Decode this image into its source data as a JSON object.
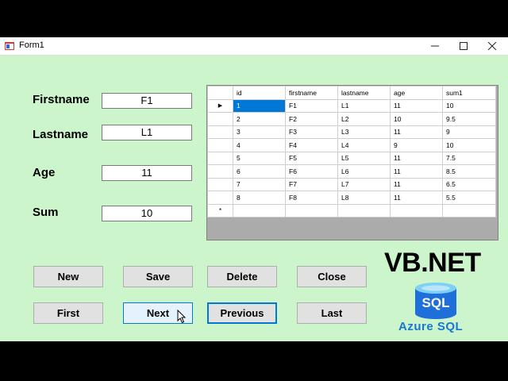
{
  "window": {
    "title": "Form1",
    "minimize": "—",
    "maximize": "☐",
    "close": "✕"
  },
  "form": {
    "firstname_label": "Firstname",
    "firstname_value": "F1",
    "lastname_label": "Lastname",
    "lastname_value": "L1",
    "age_label": "Age",
    "age_value": "11",
    "sum_label": "Sum",
    "sum_value": "10"
  },
  "grid": {
    "columns": [
      "id",
      "firstname",
      "lastname",
      "age",
      "sum1"
    ],
    "rows": [
      [
        "1",
        "F1",
        "L1",
        "11",
        "10"
      ],
      [
        "2",
        "F2",
        "L2",
        "10",
        "9.5"
      ],
      [
        "3",
        "F3",
        "L3",
        "11",
        "9"
      ],
      [
        "4",
        "F4",
        "L4",
        "9",
        "10"
      ],
      [
        "5",
        "F5",
        "L5",
        "11",
        "7.5"
      ],
      [
        "6",
        "F6",
        "L6",
        "11",
        "8.5"
      ],
      [
        "7",
        "F7",
        "L7",
        "11",
        "6.5"
      ],
      [
        "8",
        "F8",
        "L8",
        "11",
        "5.5"
      ]
    ],
    "current_row_marker": "▶",
    "new_row_marker": "*"
  },
  "buttons": {
    "new": "New",
    "save": "Save",
    "delete": "Delete",
    "close": "Close",
    "first": "First",
    "next": "Next",
    "previous": "Previous",
    "last": "Last"
  },
  "branding": {
    "vbnet": "VB.NET",
    "sql_badge": "SQL",
    "azure": "Azure SQL"
  },
  "colors": {
    "form_bg": "#ccf5cc",
    "selection": "#0078d7",
    "azure_blue": "#1976d2"
  }
}
